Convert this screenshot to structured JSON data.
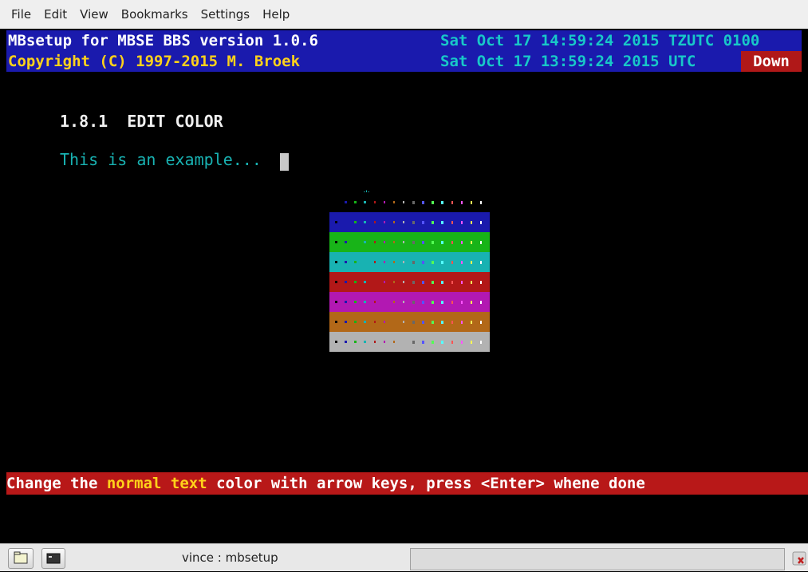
{
  "menubar": {
    "items": [
      "File",
      "Edit",
      "View",
      "Bookmarks",
      "Settings",
      "Help"
    ]
  },
  "header": {
    "line1_left": "MBsetup for MBSE BBS version 1.0.6",
    "line1_right": "Sat Oct 17 14:59:24 2015 TZUTC 0100",
    "line2_left": "Copyright (C) 1997-2015 M. Broek",
    "line2_right": "Sat Oct 17 13:59:24 2015 UTC",
    "status_badge": "Down"
  },
  "screen": {
    "title": "1.8.1  EDIT COLOR",
    "example_text": "This is an example...",
    "selector_mark": "*"
  },
  "palette": {
    "backgrounds": [
      "#000000",
      "#1a1aad",
      "#18b418",
      "#18b2b2",
      "#b21818",
      "#b218b2",
      "#b26818",
      "#b2b2b2"
    ],
    "foregrounds": [
      "#000000",
      "#1a1aad",
      "#18b418",
      "#18b2b2",
      "#b21818",
      "#b218b2",
      "#b26818",
      "#b2b2b2",
      "#686868",
      "#5454ff",
      "#54ff54",
      "#54ffff",
      "#ff5454",
      "#ff54ff",
      "#ffff54",
      "#ffffff"
    ],
    "selected_fg": 3,
    "selected_bg": 0
  },
  "status": {
    "prefix": "Change the ",
    "highlight": "normal text",
    "suffix": " color with arrow keys, press <Enter> whene done"
  },
  "taskbar": {
    "window_label": "vince : mbsetup"
  }
}
